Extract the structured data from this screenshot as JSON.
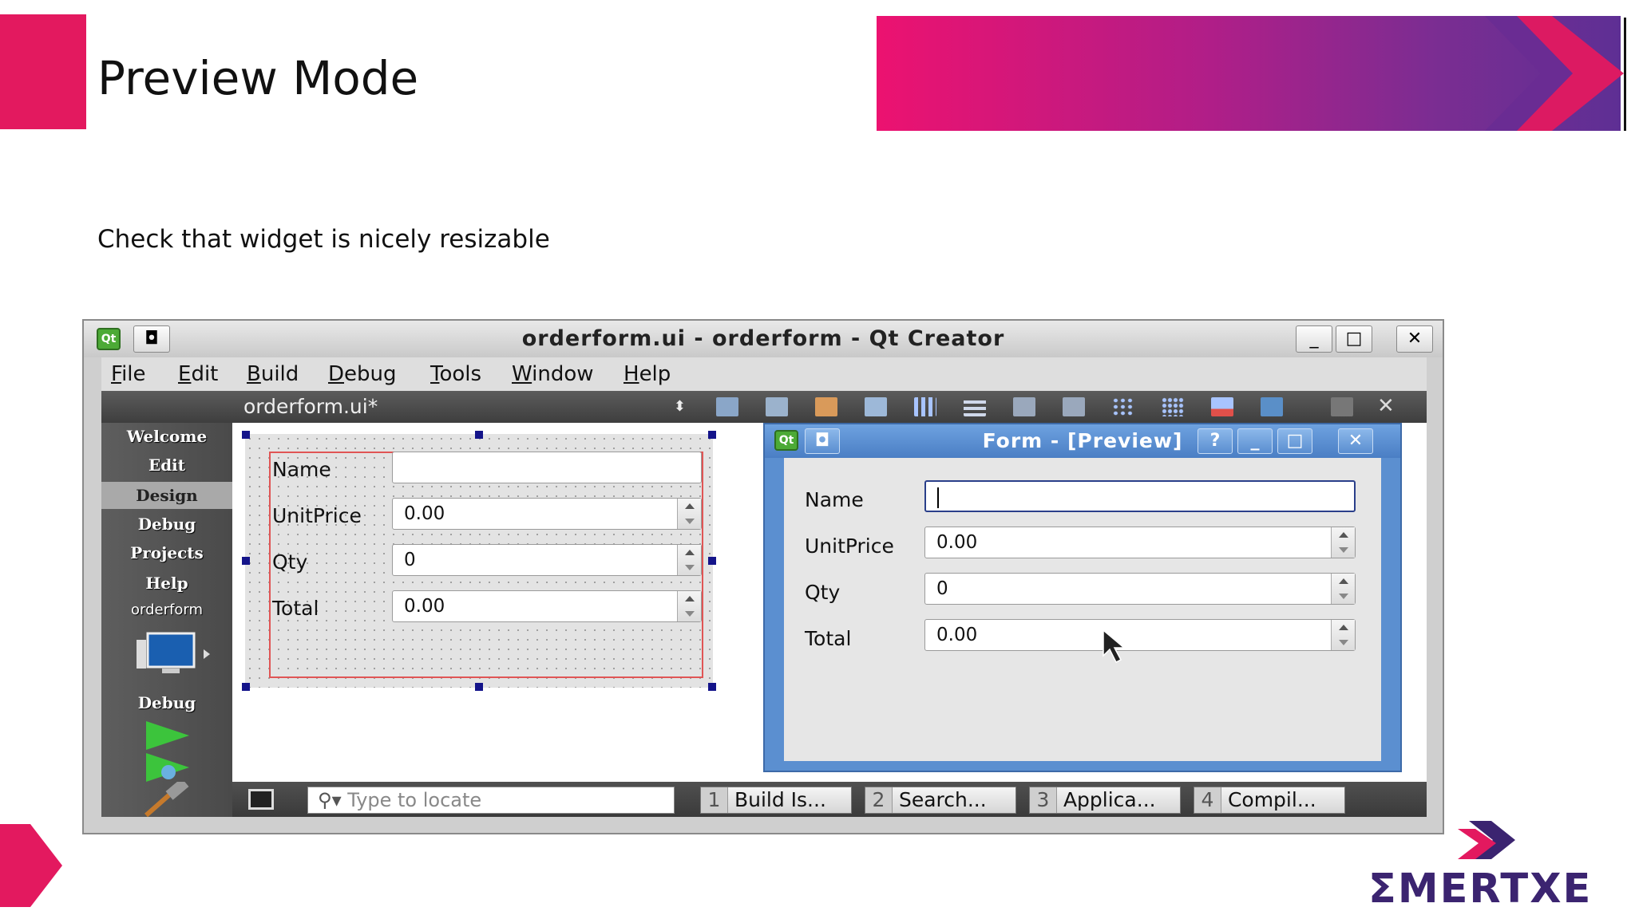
{
  "slide": {
    "title": "Preview Mode",
    "subtitle": "Check that widget is nicely resizable",
    "logo_text": "ΣMERTXE",
    "colors": {
      "accent": "#e3195f",
      "banner_start": "#ec1270",
      "banner_end": "#5e2f94",
      "logo": "#3b2470"
    }
  },
  "window": {
    "title": "orderform.ui - orderform - Qt Creator",
    "app_icon": "qt-icon",
    "menu": [
      {
        "key": "F",
        "rest": "ile"
      },
      {
        "key": "E",
        "rest": "dit"
      },
      {
        "key": "B",
        "rest": "uild"
      },
      {
        "key": "D",
        "rest": "ebug"
      },
      {
        "key": "T",
        "rest": "ools"
      },
      {
        "key": "W",
        "rest": "indow"
      },
      {
        "key": "H",
        "rest": "elp"
      }
    ],
    "file_combo": "orderform.ui*",
    "sidebar": {
      "modes": [
        "Welcome",
        "Edit",
        "Design",
        "Debug",
        "Projects",
        "Help"
      ],
      "selected": "Design",
      "project": "orderform",
      "target_label": "Debug"
    },
    "locator_placeholder": "Type to locate",
    "output_tabs": [
      {
        "num": "1",
        "label": "Build Is..."
      },
      {
        "num": "2",
        "label": "Search..."
      },
      {
        "num": "3",
        "label": "Applica..."
      },
      {
        "num": "4",
        "label": "Compil..."
      }
    ]
  },
  "form": {
    "fields": [
      {
        "label": "Name",
        "value": ""
      },
      {
        "label": "UnitPrice",
        "value": "0.00"
      },
      {
        "label": "Qty",
        "value": "0"
      },
      {
        "label": "Total",
        "value": "0.00"
      }
    ]
  },
  "preview": {
    "title": "Form - [Preview]",
    "help_label": "?"
  }
}
